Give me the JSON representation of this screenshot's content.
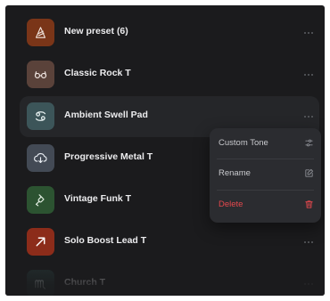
{
  "presets": [
    {
      "label": "New preset (6)",
      "icon": "pick-icon",
      "color": "#7a3518"
    },
    {
      "label": "Classic Rock T",
      "icon": "glasses-icon",
      "color": "#5a423a"
    },
    {
      "label": "Ambient Swell Pad",
      "icon": "cancer-icon",
      "color": "#3c5559",
      "selected": true
    },
    {
      "label": "Progressive Metal T",
      "icon": "cloud-download-icon",
      "color": "#434a55"
    },
    {
      "label": "Vintage Funk T",
      "icon": "plug-icon",
      "color": "#2c5331"
    },
    {
      "label": "Solo Boost Lead T",
      "icon": "arrow-up-right-icon",
      "color": "#8c2c1a"
    },
    {
      "label": "Church T",
      "icon": "scorpio-icon",
      "color": "#273a3a"
    }
  ],
  "context_menu": {
    "items": [
      {
        "label": "Custom Tone",
        "icon": "sliders-icon"
      },
      {
        "label": "Rename",
        "icon": "edit-icon"
      },
      {
        "label": "Delete",
        "icon": "trash-icon",
        "color": "#e5484d"
      }
    ]
  },
  "colors": {
    "background": "#1b1b1d",
    "selected_row": "#252629",
    "menu_background": "#2b2c30",
    "danger": "#e5484d"
  }
}
